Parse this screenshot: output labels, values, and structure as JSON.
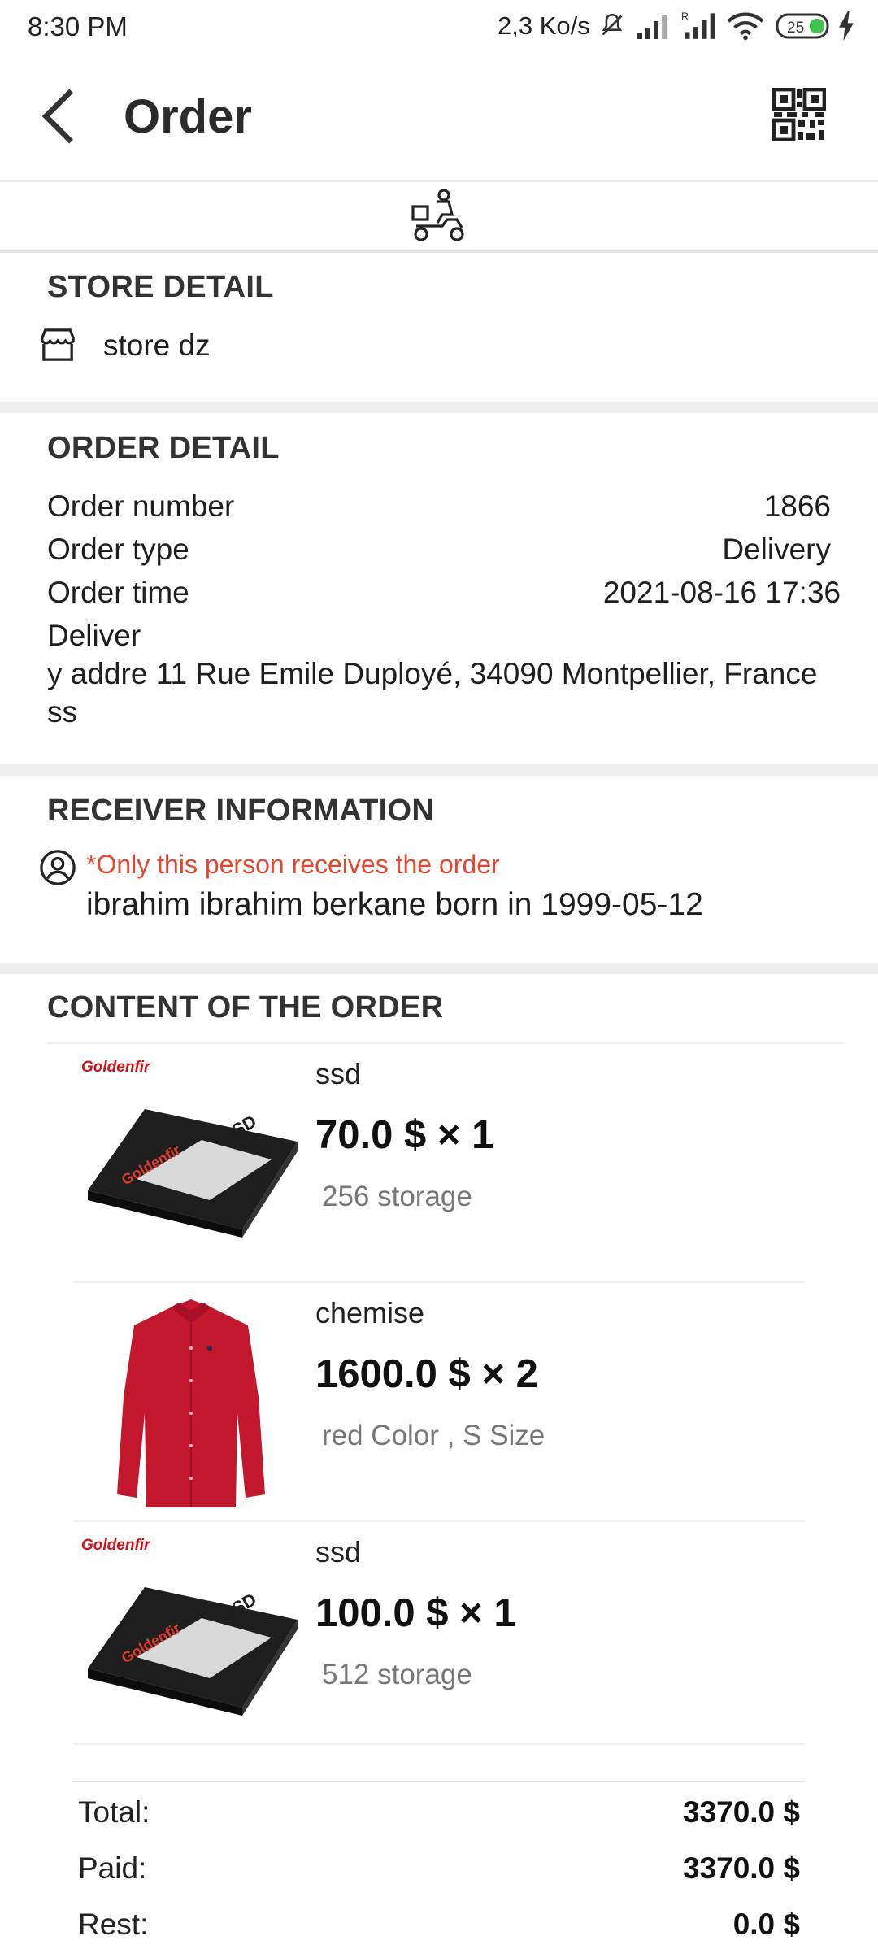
{
  "status_bar": {
    "time": "8:30 PM",
    "net_speed": "2,3 Ko/s",
    "battery": "25"
  },
  "app_bar": {
    "title": "Order"
  },
  "store": {
    "heading": "STORE DETAIL",
    "name": "store dz"
  },
  "order_detail": {
    "heading": "ORDER DETAIL",
    "number_label": "Order number",
    "number_value": "1866",
    "type_label": "Order type",
    "type_value": "Delivery",
    "time_label": "Order time",
    "time_value": "2021-08-16 17:36",
    "address_line1": "Deliver",
    "address_line2": "y addre 11 Rue Emile Duployé, 34090 Montpellier, France",
    "address_line3": "ss"
  },
  "receiver": {
    "heading": "RECEIVER INFORMATION",
    "note": "*Only this person receives the order",
    "name": "ibrahim ibrahim berkane born in 1999-05-12"
  },
  "content": {
    "heading": "CONTENT OF THE ORDER",
    "items": [
      {
        "name": "ssd",
        "price": "70.0 $ × 1",
        "variant": "256 storage",
        "brand": "Goldenfir",
        "image": "ssd"
      },
      {
        "name": "chemise",
        "price": "1600.0 $ × 2",
        "variant": "red Color , S Size",
        "image": "shirt"
      },
      {
        "name": "ssd",
        "price": "100.0 $ × 1",
        "variant": "512 storage",
        "brand": "Goldenfir",
        "image": "ssd"
      }
    ]
  },
  "totals": {
    "total_label": "Total:",
    "total_value": "3370.0 $",
    "paid_label": "Paid:",
    "paid_value": "3370.0 $",
    "rest_label": "Rest:",
    "rest_value": "0.0 $"
  },
  "colors": {
    "accent_red": "#e4462f",
    "divider": "#eeeeee",
    "text_muted": "#777777"
  },
  "icons": [
    "back-arrow-icon",
    "qr-code-icon",
    "delivery-scooter-icon",
    "store-icon",
    "user-circle-icon",
    "mute-icon",
    "signal-icon",
    "wifi-icon",
    "battery-icon",
    "charging-icon"
  ]
}
